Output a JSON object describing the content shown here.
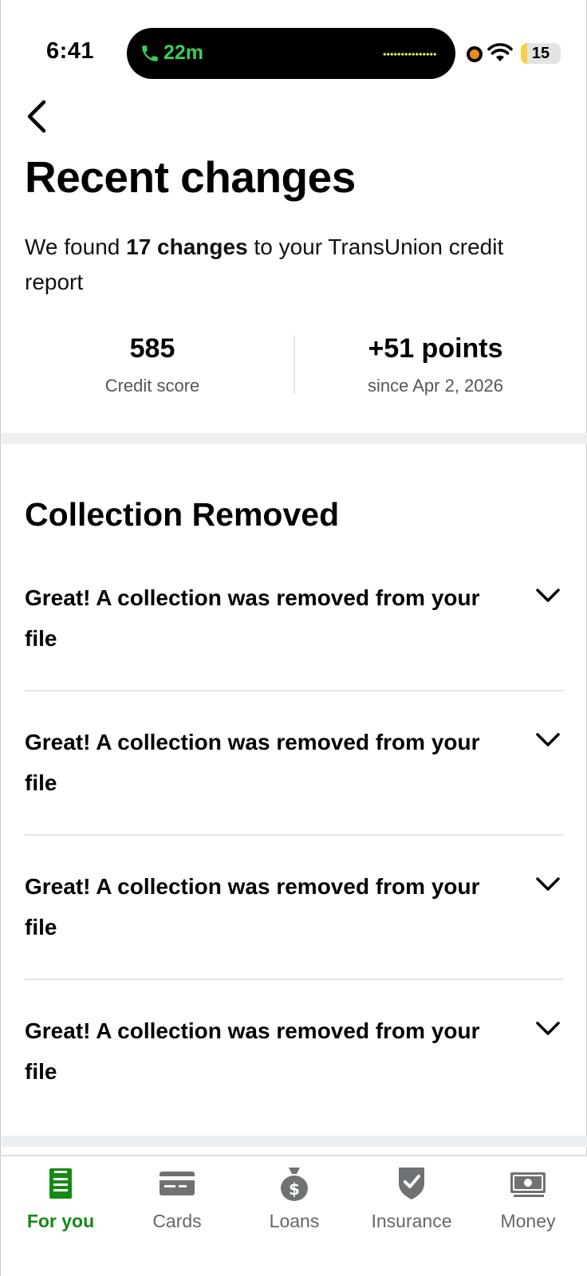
{
  "status_bar": {
    "time": "6:41",
    "call_duration": "22m",
    "battery": "15",
    "battery_level": 0.15
  },
  "page": {
    "title": "Recent changes",
    "subtitle_prefix": "We found ",
    "subtitle_bold": "17 changes",
    "subtitle_suffix": " to your TransUnion credit report"
  },
  "stats": {
    "score_value": "585",
    "score_label": "Credit score",
    "change_value": "+51 points",
    "change_label": "since Apr 2, 2026"
  },
  "section": {
    "title": "Collection Removed",
    "items": [
      {
        "text": "Great! A collection was removed from your file"
      },
      {
        "text": "Great! A collection was removed from your file"
      },
      {
        "text": "Great! A collection was removed from your file"
      },
      {
        "text": "Great! A collection was removed from your file"
      }
    ]
  },
  "nav": {
    "items": [
      {
        "label": "For you",
        "icon": "document-icon",
        "active": true
      },
      {
        "label": "Cards",
        "icon": "credit-card-icon"
      },
      {
        "label": "Loans",
        "icon": "money-bag-icon"
      },
      {
        "label": "Insurance",
        "icon": "shield-check-icon"
      },
      {
        "label": "Money",
        "icon": "banknote-icon"
      }
    ]
  },
  "colors": {
    "accent_green": "#148a14",
    "call_green": "#35d15a",
    "band_gray": "#eceff1",
    "nav_icon_gray": "#6e7275"
  }
}
